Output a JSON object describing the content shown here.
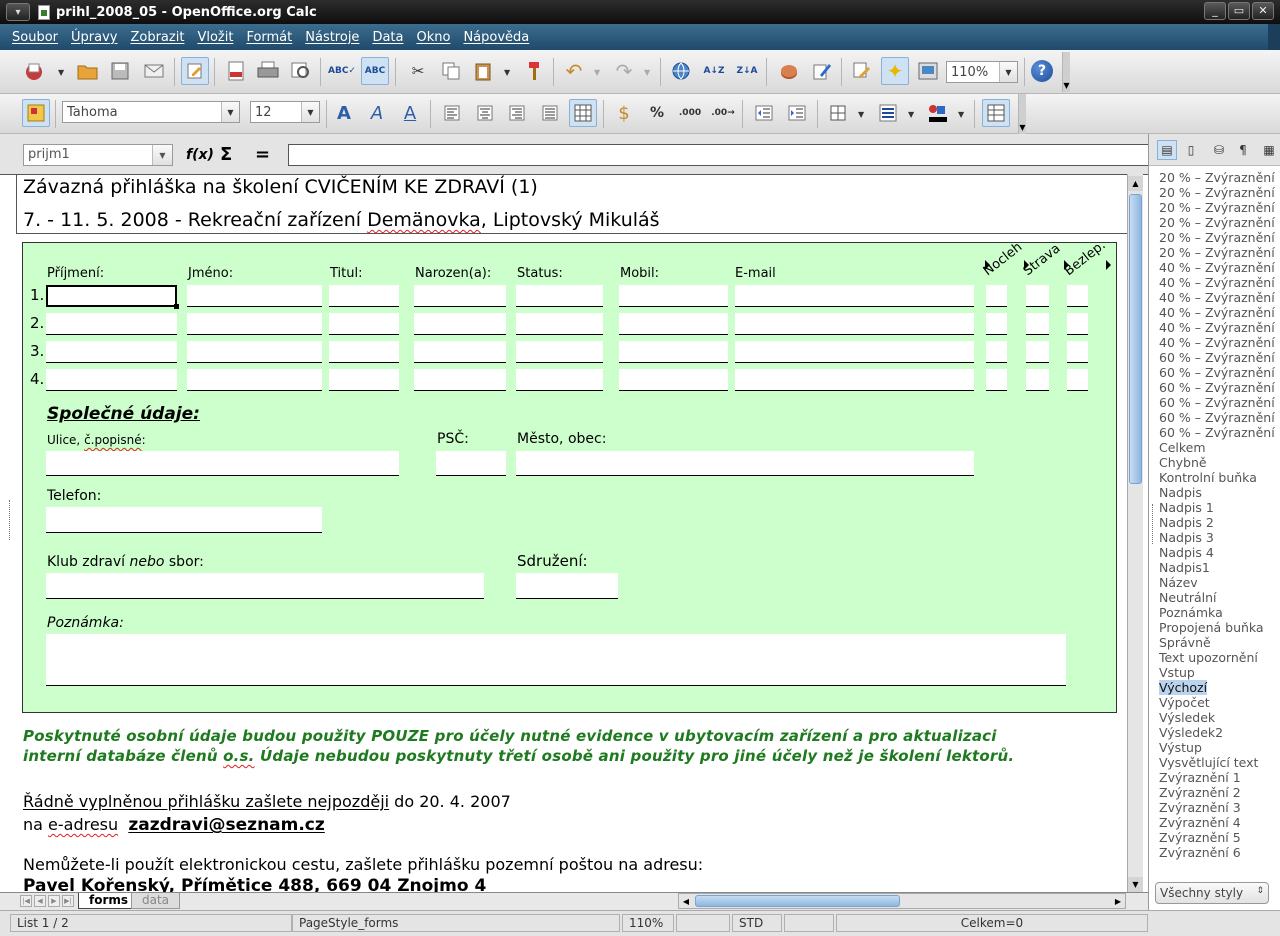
{
  "window": {
    "title": "prihl_2008_05 - OpenOffice.org Calc",
    "controls": [
      "_",
      "▭",
      "✕"
    ]
  },
  "menu": [
    "Soubor",
    "Úpravy",
    "Zobrazit",
    "Vložit",
    "Formát",
    "Nástroje",
    "Data",
    "Okno",
    "Nápověda"
  ],
  "toolbar": {
    "zoom": "110%",
    "help": "?"
  },
  "format_toolbar": {
    "font_name": "Tahoma",
    "font_size": "12"
  },
  "formula_bar": {
    "name_box": "prijm1",
    "fx": "f(x)",
    "sum": "Σ",
    "equals": "=",
    "content": ""
  },
  "document": {
    "title": "Závazná přihláška na školení CVIČENÍM KE ZDRAVÍ (1)",
    "subtitle_pre": "7. - 11. 5. 2008 - Rekreační zařízení ",
    "subtitle_word": "Demänovka",
    "subtitle_post": ", Liptovský Mikuláš",
    "columns": [
      "Příjmení:",
      "Jméno:",
      "Titul:",
      "Narozen(a):",
      "Status:",
      "Mobil:",
      "E-mail"
    ],
    "rotated_columns": [
      "Nocleh",
      "Strava",
      "Bezlep."
    ],
    "row_numbers": [
      "1.",
      "2.",
      "3.",
      "4."
    ],
    "section_title": "Společné údaje:",
    "street_pre": "Ulice, ",
    "street_word": "č.popisné",
    "street_post": ":",
    "psc": "PSČ:",
    "city": "Město, obec:",
    "phone": "Telefon:",
    "club_pre": "Klub zdraví ",
    "club_italic": "nebo",
    "club_post": " sbor:",
    "association": "Sdružení:",
    "note": "Poznámka:",
    "notice_line1": "Poskytnuté osobní údaje budou použity POUZE pro účely nutné evidence v ubytovacím zařízení a pro aktualizaci",
    "notice_line2_pre": "interní databáze členů ",
    "notice_line2_word": "o.s.",
    "notice_line2_post": " Údaje nebudou poskytnuty třetí osobě ani použity pro jiné účely než je školení lektorů.",
    "send_underlined": "Řádně vyplněnou přihlášku zašlete nejpozději",
    "send_rest": " do 20. 4. 2007",
    "email_pre": "na ",
    "email_word": "e-adresu",
    "email_address": "zazdravi@seznam.cz",
    "post_line": "Nemůžete-li použít elektronickou cestu, zašlete přihlášku pozemní poštou na adresu:",
    "post_address": "Pavel Kořenský, Přímětice 488, 669 04 Znojmo 4"
  },
  "sheet_tabs": [
    "forms",
    "data"
  ],
  "status": {
    "sheet": "List 1 / 2",
    "page_style": "PageStyle_forms",
    "zoom": "110%",
    "mode": "STD",
    "sum": "Celkem=0"
  },
  "styles_panel": {
    "items": [
      "20 % – Zvýraznění 1",
      "20 % – Zvýraznění 2",
      "20 % – Zvýraznění 3",
      "20 % – Zvýraznění 4",
      "20 % – Zvýraznění 5",
      "20 % – Zvýraznění 6",
      "40 % – Zvýraznění 1",
      "40 % – Zvýraznění 2",
      "40 % – Zvýraznění 3",
      "40 % – Zvýraznění 4",
      "40 % – Zvýraznění 5",
      "40 % – Zvýraznění 6",
      "60 % – Zvýraznění 1",
      "60 % – Zvýraznění 2",
      "60 % – Zvýraznění 3",
      "60 % – Zvýraznění 4",
      "60 % – Zvýraznění 5",
      "60 % – Zvýraznění 6",
      "Celkem",
      "Chybně",
      "Kontrolní buňka",
      "Nadpis",
      "Nadpis 1",
      "Nadpis 2",
      "Nadpis 3",
      "Nadpis 4",
      "Nadpis1",
      "Název",
      "Neutrální",
      "Poznámka",
      "Propojená buňka",
      "Správně",
      "Text upozornění",
      "Vstup",
      "Výchozí",
      "Výpočet",
      "Výsledek",
      "Výsledek2",
      "Výstup",
      "Vysvětlující text",
      "Zvýraznění 1",
      "Zvýraznění 2",
      "Zvýraznění 3",
      "Zvýraznění 4",
      "Zvýraznění 5",
      "Zvýraznění 6"
    ],
    "selected": "Výchozí",
    "filter": "Všechny styly"
  },
  "colors": {
    "form_background": "#ccffcc",
    "notice_text": "#1e7a1e",
    "menubar": "#2d5a7c"
  }
}
